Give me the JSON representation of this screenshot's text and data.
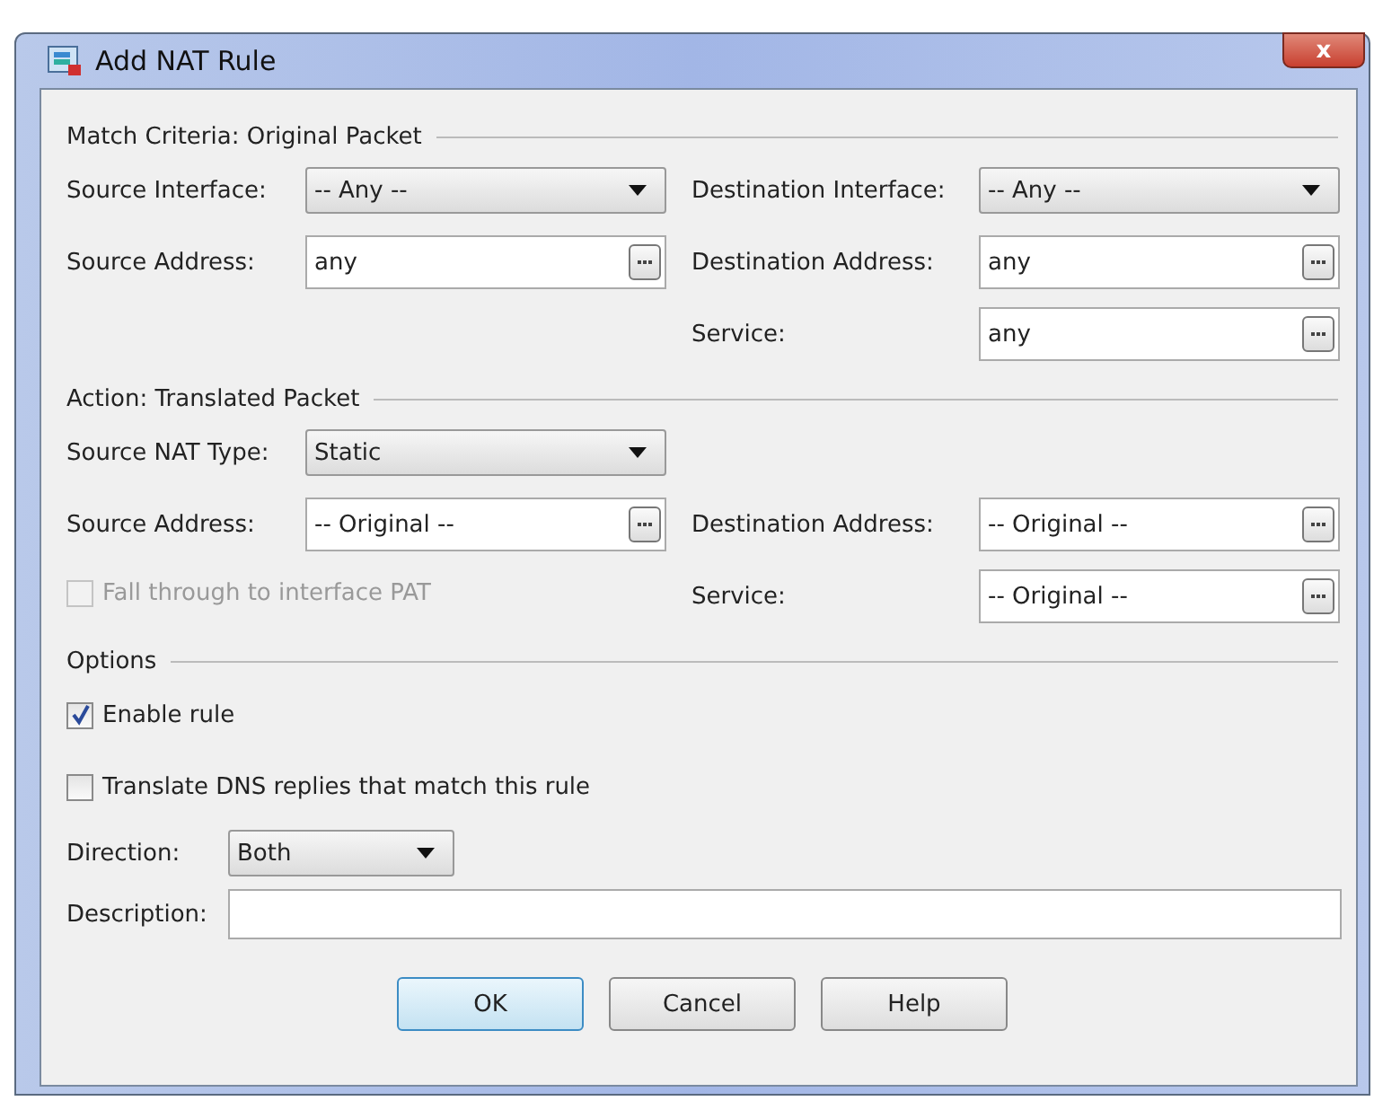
{
  "window": {
    "title": "Add NAT Rule",
    "close": "x"
  },
  "sections": [
    {
      "title": "Match Criteria: Original Packet",
      "rows": [
        {
          "left": {
            "kind": "select",
            "label": "Source Interface:",
            "value": "-- Any --"
          },
          "right": {
            "kind": "select",
            "label": "Destination Interface:",
            "value": "-- Any --"
          }
        },
        {
          "left": {
            "kind": "browse",
            "label": "Source Address:",
            "value": "any"
          },
          "right": {
            "kind": "browse",
            "label": "Destination Address:",
            "value": "any"
          }
        },
        {
          "right": {
            "kind": "browse",
            "label": "Service:",
            "value": "any"
          }
        }
      ]
    },
    {
      "title": "Action: Translated Packet",
      "rows": [
        {
          "left": {
            "kind": "select",
            "label": "Source NAT Type:",
            "value": "Static"
          }
        },
        {
          "left": {
            "kind": "browse",
            "label": "Source Address:",
            "value": "-- Original --"
          },
          "right": {
            "kind": "browse",
            "label": "Destination Address:",
            "value": "-- Original --"
          }
        },
        {
          "left": {
            "kind": "checkbox",
            "label": "Fall through to interface PAT",
            "checked": false,
            "disabled": true
          },
          "right": {
            "kind": "browse",
            "label": "Service:",
            "value": "-- Original --"
          }
        }
      ]
    }
  ],
  "options": {
    "title": "Options",
    "items": [
      {
        "kind": "checkbox",
        "label": "Enable rule",
        "checked": true,
        "disabled": false
      },
      {
        "kind": "checkbox",
        "label": "Translate DNS replies that match this rule",
        "checked": false,
        "disabled": false
      },
      {
        "kind": "select",
        "label": "Direction:",
        "value": "Both"
      },
      {
        "kind": "text",
        "label": "Description:"
      }
    ]
  },
  "buttons": [
    {
      "label": "OK",
      "default": true
    },
    {
      "label": "Cancel",
      "default": false
    },
    {
      "label": "Help",
      "default": false
    }
  ]
}
